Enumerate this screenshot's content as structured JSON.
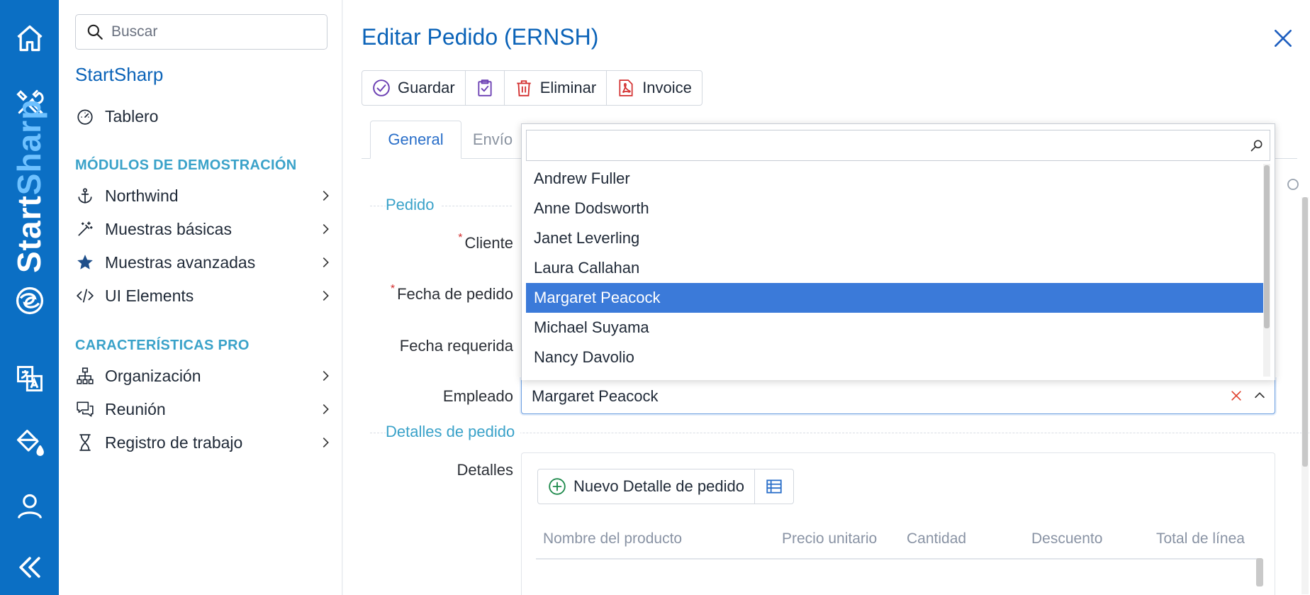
{
  "rail": {
    "brand": {
      "part1": "Start",
      "part2": "Sharp"
    },
    "colors": {
      "rail_bg": "#0b6fc4",
      "brand_accent": "#6ec1ff"
    },
    "icons": [
      "home-icon",
      "tools-icon",
      "logo-icon",
      "translate-icon",
      "paint-bucket-icon",
      "user-icon",
      "collapse-icon"
    ]
  },
  "sidenav": {
    "search_placeholder": "Buscar",
    "title": "StartSharp",
    "dashboard": "Tablero",
    "section_demo": "MÓDULOS DE DEMOSTRACIÓN",
    "demo_items": [
      "Northwind",
      "Muestras básicas",
      "Muestras avanzadas",
      "UI Elements"
    ],
    "section_pro": "CARACTERÍSTICAS PRO",
    "pro_items": [
      "Organización",
      "Reunión",
      "Registro de trabajo"
    ]
  },
  "dialog": {
    "title": "Editar Pedido (ERNSH)",
    "toolbar": {
      "save": "Guardar",
      "delete": "Eliminar",
      "invoice": "Invoice"
    },
    "tabs": [
      "General",
      "Envío"
    ],
    "fieldset_order": "Pedido",
    "labels": {
      "customer": "Cliente",
      "order_date": "Fecha de pedido",
      "required_date": "Fecha requerida",
      "employee": "Empleado"
    },
    "employee_value": "Margaret Peacock",
    "fieldset_details": "Detalles de pedido",
    "details_label": "Detalles",
    "new_detail": "Nuevo Detalle de pedido",
    "grid_columns": [
      "Nombre del producto",
      "Precio unitario",
      "Cantidad",
      "Descuento",
      "Total de línea"
    ]
  },
  "dropdown": {
    "items": [
      "Andrew Fuller",
      "Anne Dodsworth",
      "Janet Leverling",
      "Laura Callahan",
      "Margaret Peacock",
      "Michael Suyama",
      "Nancy Davolio"
    ],
    "selected": "Margaret Peacock",
    "selected_color": "#3b7ad9"
  }
}
